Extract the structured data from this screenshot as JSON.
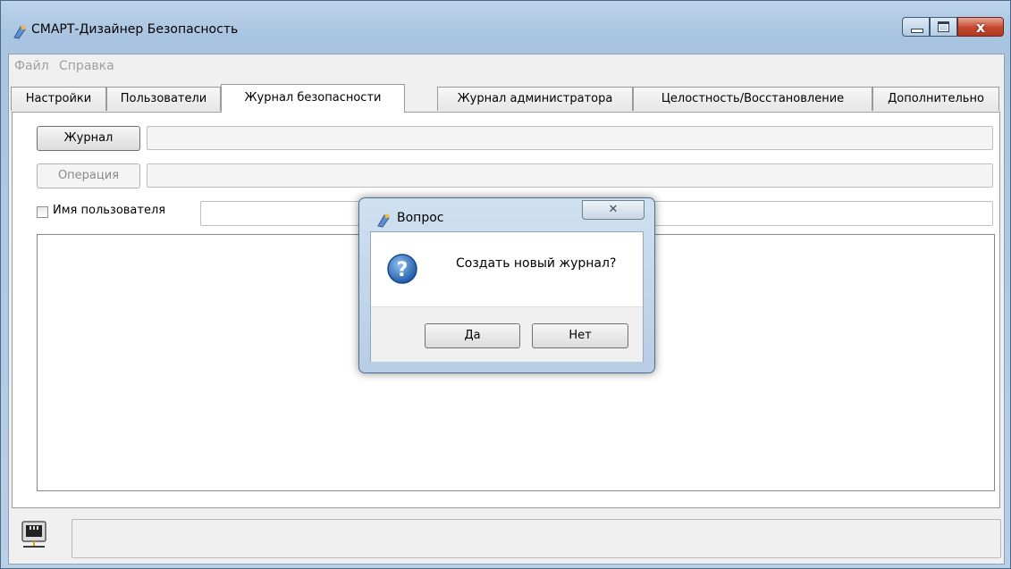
{
  "window": {
    "title": "СМАРТ-Дизайнер Безопасность",
    "icon": "app-logo-icon"
  },
  "menu": [
    "Файл",
    "Справка"
  ],
  "tabs": [
    {
      "label": "Настройки",
      "active": false
    },
    {
      "label": "Пользователи",
      "active": false
    },
    {
      "label": "Журнал безопасности",
      "active": true
    },
    {
      "label": "Журнал администратора",
      "active": false
    },
    {
      "label": "Целостность/Восстановление",
      "active": false
    },
    {
      "label": "Дополнительно",
      "active": false
    }
  ],
  "security_log": {
    "journal_button": "Журнал",
    "journal_value": "",
    "operation_button": "Операция",
    "operation_value": "",
    "username_checkbox_label": "Имя пользователя",
    "username_checked": false,
    "username_value": ""
  },
  "statusbar": {
    "icon": "network-connection-icon",
    "text": ""
  },
  "dialog": {
    "title": "Вопрос",
    "close_glyph": "✕",
    "icon": "question-icon",
    "message": "Создать новый журнал?",
    "yes_label": "Да",
    "no_label": "Нет"
  },
  "colors": {
    "title_bar": "#b8cfe7",
    "close_button": "#c4462e",
    "question_icon": "#2c6db5"
  }
}
